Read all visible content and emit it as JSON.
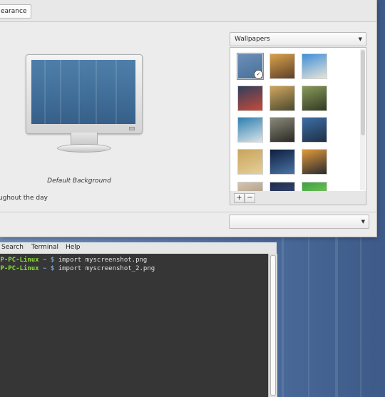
{
  "appearance": {
    "tab_label": "earance",
    "background_name": "Default Background",
    "slideshow_label": "ughout the day",
    "wallpapers_dropdown": "Wallpapers",
    "add_label": "+",
    "remove_label": "−",
    "thumbnails": [
      {
        "name": "default-blue",
        "selected": true,
        "colors": [
          "#6d8fb7",
          "#46709a"
        ]
      },
      {
        "name": "sunset-clouds",
        "colors": [
          "#d9a24a",
          "#5e3f2a"
        ]
      },
      {
        "name": "sky-wall",
        "colors": [
          "#3f8fd8",
          "#e8e4d8"
        ]
      },
      {
        "name": "city-night",
        "colors": [
          "#2e3f5c",
          "#c84a3a"
        ]
      },
      {
        "name": "field-sunset",
        "colors": [
          "#d0a560",
          "#4a4a2e"
        ]
      },
      {
        "name": "green-grass",
        "colors": [
          "#8a9a5c",
          "#2f3a22"
        ]
      },
      {
        "name": "coast-blue",
        "colors": [
          "#2f7fb0",
          "#d8e4e8"
        ]
      },
      {
        "name": "railway-tunnel",
        "colors": [
          "#8a8a7a",
          "#2a2a24"
        ]
      },
      {
        "name": "road-horizon",
        "colors": [
          "#3d6fa8",
          "#1e2f44"
        ]
      },
      {
        "name": "sand-dune",
        "colors": [
          "#c9a45c",
          "#e4cf98"
        ]
      },
      {
        "name": "night-sky",
        "colors": [
          "#0f1e3c",
          "#4a74a8"
        ]
      },
      {
        "name": "orange-dusk",
        "colors": [
          "#e09a3a",
          "#2a2a30"
        ]
      },
      {
        "name": "pale-cloud",
        "colors": [
          "#d4c4b0",
          "#9a8a70"
        ]
      },
      {
        "name": "dark-sky",
        "colors": [
          "#1e2a4a",
          "#40588a"
        ]
      },
      {
        "name": "green-leaf",
        "colors": [
          "#3aa040",
          "#9fd86a"
        ]
      }
    ]
  },
  "terminal": {
    "menu": [
      "Search",
      "Terminal",
      "Help"
    ],
    "lines": [
      {
        "host": "HP-PC-Linux",
        "path": "~",
        "prompt": "$",
        "command": "import myscreenshot.png"
      },
      {
        "host": "HP-PC-Linux",
        "path": "~",
        "prompt": "$",
        "command": "import myscreenshot_2.png"
      }
    ]
  }
}
